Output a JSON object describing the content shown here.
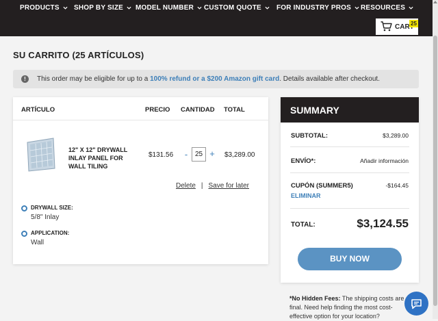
{
  "nav": {
    "items": [
      {
        "label": "PRODUCTS"
      },
      {
        "label": "SHOP BY SIZE"
      },
      {
        "label": "MODEL NUMBER"
      },
      {
        "label": "CUSTOM QUOTE"
      },
      {
        "label": "FOR INDUSTRY PROS"
      },
      {
        "label": "RESOURCES"
      }
    ],
    "cart_label": "CART",
    "cart_count": "25"
  },
  "page_title": "SU CARRITO (25 ARTÍCULOS)",
  "notice": {
    "prefix": "This order may be eligible for up to a ",
    "link": "100% refund or a $200 Amazon gift card",
    "suffix": ". Details available after checkout."
  },
  "cart_table": {
    "headers": {
      "item": "ARTÍCULO",
      "price": "PRECIO",
      "qty": "CANTIDAD",
      "total": "TOTAL"
    },
    "item": {
      "name": "12\" X 12\" DRYWALL INLAY PANEL FOR WALL TILING",
      "price": "$131.56",
      "qty": "25",
      "total": "$3,289.00",
      "minus": "-",
      "plus": "+"
    },
    "actions": {
      "delete": "Delete",
      "separator": "|",
      "save": "Save for later"
    },
    "attributes": [
      {
        "label": "DRYWALL SIZE:",
        "value": "5/8\" Inlay"
      },
      {
        "label": "APPLICATION:",
        "value": "Wall"
      }
    ]
  },
  "summary": {
    "title": "SUMMARY",
    "subtotal_label": "SUBTOTAL:",
    "subtotal_value": "$3,289.00",
    "shipping_label": "ENVÍO*:",
    "shipping_value": "Añadir información",
    "coupon_label": "CUPÓN (SUMMER5)",
    "coupon_value": "-$164.45",
    "coupon_remove": "ELIMINAR",
    "total_label": "TOTAL:",
    "total_value": "$3,124.55",
    "buy_button": "BUY NOW"
  },
  "footnote": {
    "bold": "*No Hidden Fees:",
    "text": " The shipping costs are final. Need help finding the most cost-effective option for your location?"
  },
  "colors": {
    "nav_bg": "#231f20",
    "accent": "#3d7fb8",
    "buy_button": "#5b93c3",
    "cart_badge": "#f2e400",
    "chat_button": "#2f72c4"
  },
  "icons": [
    "cart-icon",
    "info-icon",
    "chevron-down-icon",
    "chat-icon"
  ]
}
